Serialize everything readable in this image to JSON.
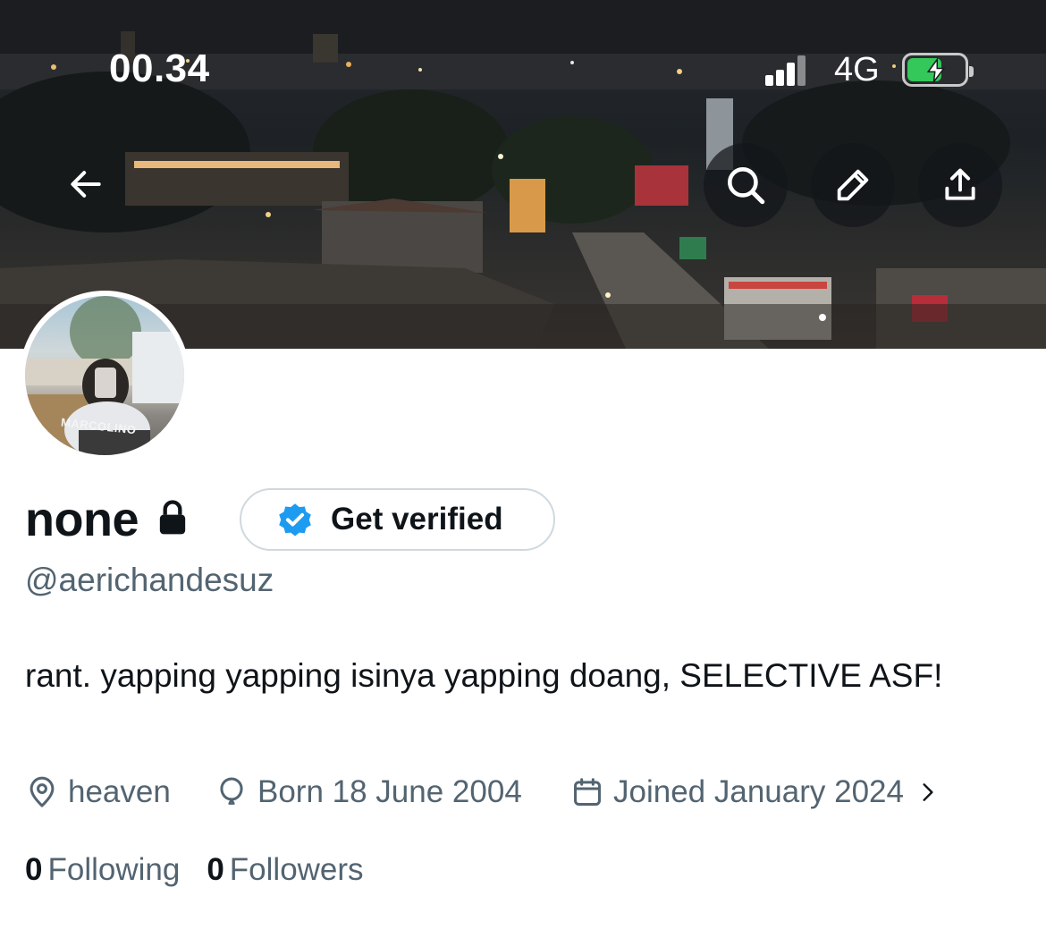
{
  "status_bar": {
    "time": "00.34",
    "network": "4G"
  },
  "header": {
    "back_icon": "arrow-left-icon",
    "search_icon": "search-icon",
    "edit_icon": "pencil-icon",
    "share_icon": "share-icon"
  },
  "profile": {
    "display_name": "none",
    "protected_icon": "lock-icon",
    "get_verified_label": "Get verified",
    "verified_badge_color": "#1d9bf0",
    "handle": "@aerichandesuz",
    "bio": "rant. yapping yapping isinya yapping doang, SELECTIVE ASF!",
    "avatar_watermark": "MARCOLINO",
    "location": "heaven",
    "birth": "Born 18 June 2004",
    "joined": "Joined January 2024",
    "following_count": "0",
    "following_label": "Following",
    "followers_count": "0",
    "followers_label": "Followers"
  },
  "colors": {
    "text_primary": "#0f1419",
    "text_secondary": "#536471",
    "border": "#cfd9de",
    "battery_green": "#34c759"
  }
}
